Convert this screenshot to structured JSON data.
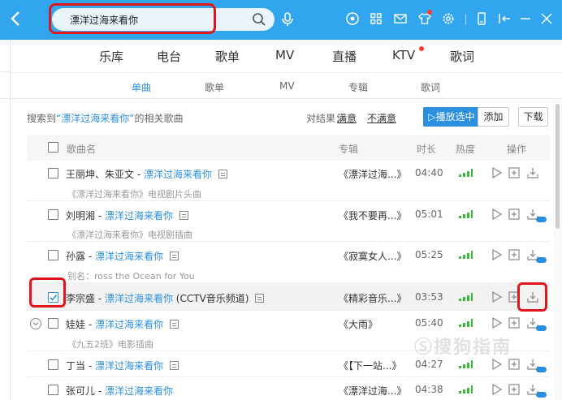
{
  "search": {
    "query": "漂洋过海来看你"
  },
  "main_nav": [
    "乐库",
    "电台",
    "歌单",
    "MV",
    "直播",
    "KTV",
    "歌词"
  ],
  "sub_nav": {
    "items": [
      "单曲",
      "歌单",
      "MV",
      "专辑",
      "歌词"
    ],
    "active": 0
  },
  "result_bar": {
    "prefix": "搜索到",
    "keyword": "“漂洋过海来看你”",
    "suffix": "的相关歌曲",
    "rate_label": "对结果：",
    "satisfied": "满意",
    "unsatisfied": "不满意",
    "play_selected": "▷播放选中",
    "add": "添加",
    "download": "下载"
  },
  "table": {
    "headers": {
      "song": "歌曲名",
      "album": "专辑",
      "duration": "时长",
      "heat": "热度",
      "actions": "操作"
    },
    "rows": [
      {
        "artist": "王丽坤、朱亚文 - ",
        "title": "漂洋过海来看你",
        "extra": "",
        "sub": "《漂洋过海来看你》电视剧片头曲",
        "album": "《漂洋过海...》",
        "duration": "04:40",
        "checked": false,
        "sq": false
      },
      {
        "artist": "刘明湘 - ",
        "title": "漂洋过海来看你",
        "extra": "",
        "sub": "《漂洋过海来看你》电视剧插曲",
        "album": "《我不要再...》",
        "duration": "05:01",
        "checked": false,
        "sq": true
      },
      {
        "artist": "孙露 - ",
        "title": "漂洋过海来看你",
        "extra": "",
        "sub": "别名：ross the Ocean for You",
        "album": "《寂寞女人...》",
        "duration": "05:25",
        "checked": false,
        "sq": true
      },
      {
        "artist": "李宗盛 - ",
        "title": "漂洋过海来看你",
        "extra": " (CCTV音乐频道)",
        "sub": "",
        "album": "《精彩音乐...》",
        "duration": "03:53",
        "checked": true,
        "sq": false
      },
      {
        "artist": "娃娃 - ",
        "title": "漂洋过海来看你",
        "extra": "",
        "sub": "《九五2班》电影插曲",
        "album": "《大雨》",
        "duration": "05:40",
        "checked": false,
        "sq": true
      },
      {
        "artist": "丁当 - ",
        "title": "漂洋过海来看你",
        "extra": "",
        "sub": "",
        "album": "《【下一站...》",
        "duration": "04:27",
        "checked": false,
        "sq": true
      },
      {
        "artist": "张可儿 - ",
        "title": "漂洋过海来看你",
        "extra": "",
        "sub": "",
        "album": "《漂洋过海...》",
        "duration": "04:38",
        "checked": false,
        "sq": true
      }
    ]
  },
  "colors": {
    "topbar": "#31a6ef",
    "accent": "#2b8fe0",
    "heat": "#3cb73c",
    "highlight": "#e0161c"
  },
  "watermark": "Ⓢ搜狗指南"
}
